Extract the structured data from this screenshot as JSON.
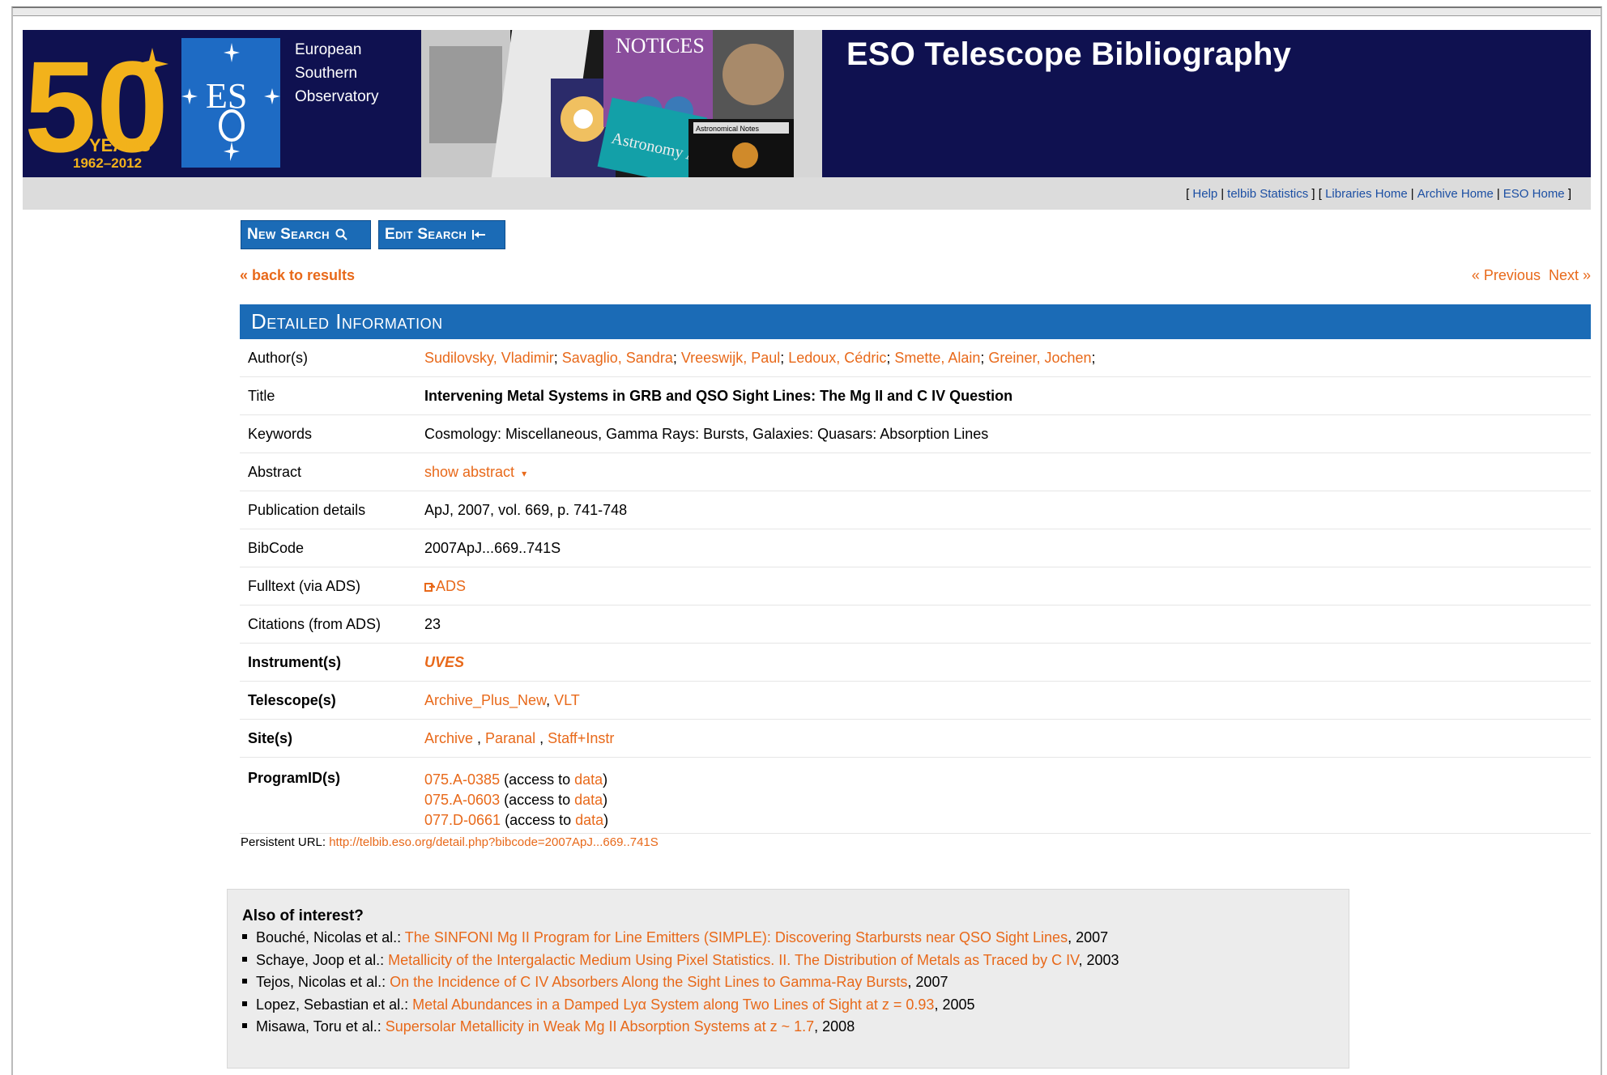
{
  "header": {
    "logo_50": "50",
    "logo_years": "YEARS",
    "logo_dates": "1962–2012",
    "eso_mark": "ES",
    "org_line1": "European",
    "org_line2": "Southern",
    "org_line3": "Observatory",
    "collage_text1": "NOTICES",
    "collage_text2": "Astronomical Notes",
    "collage_text3": "Astronomy Astrophysics",
    "site_title": "ESO Telescope Bibliography"
  },
  "nav": {
    "help": "Help",
    "stats": "telbib Statistics",
    "libraries": "Libraries Home",
    "archive": "Archive Home",
    "eso": "ESO Home"
  },
  "buttons": {
    "new_search": "New Search",
    "edit_search": "Edit Search"
  },
  "back_link": "« back to results",
  "previous": "« Previous",
  "next": "Next »",
  "detail": {
    "heading": "Detailed Information",
    "labels": {
      "authors": "Author(s)",
      "title": "Title",
      "keywords": "Keywords",
      "abstract": "Abstract",
      "pub": "Publication details",
      "bibcode": "BibCode",
      "fulltext": "Fulltext (via ADS)",
      "citations": "Citations (from ADS)",
      "instruments": "Instrument(s)",
      "telescopes": "Telescope(s)",
      "sites": "Site(s)",
      "programs": "ProgramID(s)"
    },
    "authors": [
      "Sudilovsky, Vladimir",
      "Savaglio, Sandra",
      "Vreeswijk, Paul",
      "Ledoux, Cédric",
      "Smette, Alain",
      "Greiner, Jochen"
    ],
    "title": "Intervening Metal Systems in GRB and QSO Sight Lines: The Mg II and C IV Question",
    "keywords": "Cosmology: Miscellaneous, Gamma Rays: Bursts, Galaxies: Quasars: Absorption Lines",
    "abstract_toggle": "show abstract",
    "pub": "ApJ, 2007, vol. 669, p. 741-748",
    "bibcode": "2007ApJ...669..741S",
    "fulltext": "ADS",
    "citations": "23",
    "instrument": "UVES",
    "telescopes": [
      "Archive_Plus_New",
      "VLT"
    ],
    "sites": [
      "Archive",
      "Paranal",
      "Staff+Instr"
    ],
    "programs": [
      {
        "id": "075.A-0385",
        "pre": "(access to ",
        "link": "data",
        "post": ")"
      },
      {
        "id": "075.A-0603",
        "pre": "(access to ",
        "link": "data",
        "post": ")"
      },
      {
        "id": "077.D-0661",
        "pre": "(access to ",
        "link": "data",
        "post": ")"
      }
    ]
  },
  "persistent": {
    "label": "Persistent URL:",
    "url": "http://telbib.eso.org/detail.php?bibcode=2007ApJ...669..741S"
  },
  "also": {
    "heading": "Also of interest?",
    "items": [
      {
        "author": "Bouché, Nicolas et al.:",
        "title": "The SINFONI Mg II Program for Line Emitters (SIMPLE): Discovering Starbursts near QSO Sight Lines",
        "year": ", 2007"
      },
      {
        "author": "Schaye, Joop et al.:",
        "title": "Metallicity of the Intergalactic Medium Using Pixel Statistics. II. The Distribution of Metals as Traced by C IV",
        "year": ", 2003"
      },
      {
        "author": "Tejos, Nicolas et al.:",
        "title": "On the Incidence of C IV Absorbers Along the Sight Lines to Gamma-Ray Bursts",
        "year": ", 2007"
      },
      {
        "author": "Lopez, Sebastian et al.:",
        "title": "Metal Abundances in a Damped Lyα System along Two Lines of Sight at z = 0.93",
        "year": ", 2005"
      },
      {
        "author": "Misawa, Toru et al.:",
        "title": "Supersolar Metallicity in Weak Mg II Absorption Systems at z ~ 1.7",
        "year": ", 2008"
      }
    ]
  }
}
